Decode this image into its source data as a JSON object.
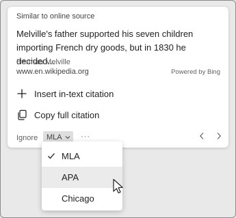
{
  "card": {
    "header": "Similar to online source",
    "excerpt": "Melville's father supported his seven children importing French dry goods, but in 1830 he decided...",
    "author": "Herman Melville",
    "url": "www.en.wikipedia.org",
    "powered_by": "Powered by Bing"
  },
  "actions": {
    "insert": "Insert in-text citation",
    "copy": "Copy full citation"
  },
  "footer": {
    "ignore": "Ignore",
    "style_selected": "MLA",
    "more": "···"
  },
  "dropdown": {
    "options": [
      "MLA",
      "APA",
      "Chicago"
    ],
    "selected": "MLA",
    "hovered": "APA"
  },
  "icons": {
    "insert": "plus-icon",
    "copy": "copy-icon",
    "selected": "checkmark-icon",
    "prev": "chevron-left-icon",
    "next": "chevron-right-icon",
    "style": "chevron-down-icon",
    "pointer": "mouse-pointer-icon"
  },
  "colors": {
    "background": "#e9e9e9",
    "card": "#ffffff",
    "hover": "#ebebeb",
    "select": "#dedede"
  }
}
